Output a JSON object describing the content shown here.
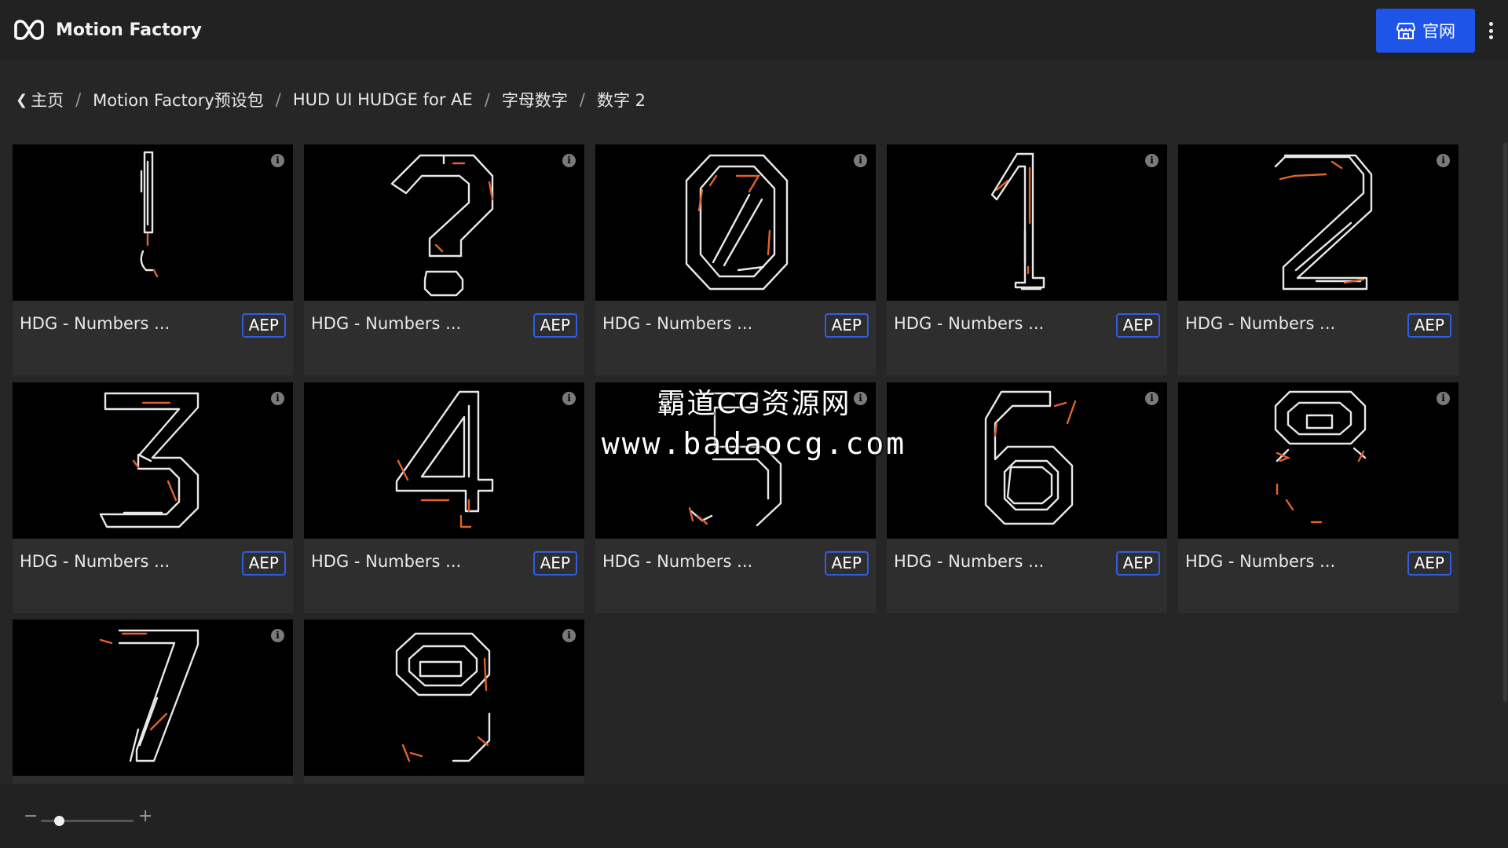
{
  "header": {
    "app_title": "Motion Factory",
    "site_button_label": "官网",
    "logo_icon": "motion-factory-logo",
    "menu_icon": "kebab-menu-icon"
  },
  "breadcrumb": {
    "items": [
      "主页",
      "Motion Factory预设包",
      "HUD UI HUDGE for AE",
      "字母数字",
      "数字 2"
    ],
    "separator": "/"
  },
  "cards": [
    {
      "title": "HDG - Numbers ...",
      "badge": "AEP",
      "glyph": "!"
    },
    {
      "title": "HDG - Numbers ...",
      "badge": "AEP",
      "glyph": "?"
    },
    {
      "title": "HDG - Numbers ...",
      "badge": "AEP",
      "glyph": "0"
    },
    {
      "title": "HDG - Numbers ...",
      "badge": "AEP",
      "glyph": "1"
    },
    {
      "title": "HDG - Numbers ...",
      "badge": "AEP",
      "glyph": "2"
    },
    {
      "title": "HDG - Numbers ...",
      "badge": "AEP",
      "glyph": "3"
    },
    {
      "title": "HDG - Numbers ...",
      "badge": "AEP",
      "glyph": "4"
    },
    {
      "title": "HDG - Numbers ...",
      "badge": "AEP",
      "glyph": "5"
    },
    {
      "title": "HDG - Numbers ...",
      "badge": "AEP",
      "glyph": "6"
    },
    {
      "title": "HDG - Numbers ...",
      "badge": "AEP",
      "glyph": "8"
    },
    {
      "title": "",
      "badge": "",
      "glyph": "7"
    },
    {
      "title": "",
      "badge": "",
      "glyph": "9"
    }
  ],
  "watermark": {
    "line1": "霸道CG资源网",
    "line2": "www.badaocg.com"
  },
  "zoom": {
    "minus": "−",
    "plus": "+",
    "level": 0.2
  },
  "colors": {
    "accent": "#1f54e8",
    "badge_border": "#2f5fe0",
    "glyph_stroke": "#e8e8e8",
    "glyph_accent": "#e0632b"
  }
}
